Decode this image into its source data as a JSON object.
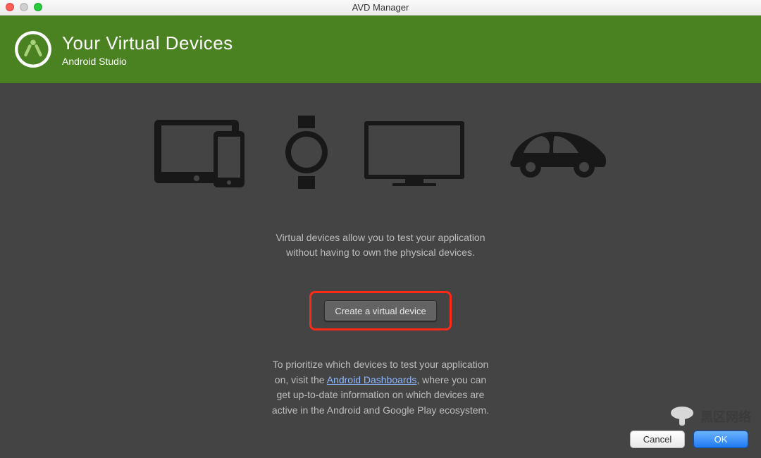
{
  "window": {
    "title": "AVD Manager"
  },
  "header": {
    "title": "Your Virtual Devices",
    "subtitle": "Android Studio"
  },
  "main": {
    "description_line1": "Virtual devices allow you to test your application",
    "description_line2": "without having to own the physical devices.",
    "create_button_label": "Create a virtual device",
    "info_line1": "To prioritize which devices to test your application",
    "info_line2_pre": "on, visit the ",
    "info_link_label": "Android Dashboards",
    "info_line2_post": ", where you can",
    "info_line3": "get up-to-date information on which devices are",
    "info_line4": "active in the Android and Google Play ecosystem."
  },
  "footer": {
    "cancel_label": "Cancel",
    "ok_label": "OK"
  },
  "watermark": {
    "text": "黑区网络"
  },
  "colors": {
    "header_bg": "#4b8221",
    "main_bg": "#444444",
    "highlight_box": "#ff2a17",
    "primary_btn": "#1e7af2"
  }
}
